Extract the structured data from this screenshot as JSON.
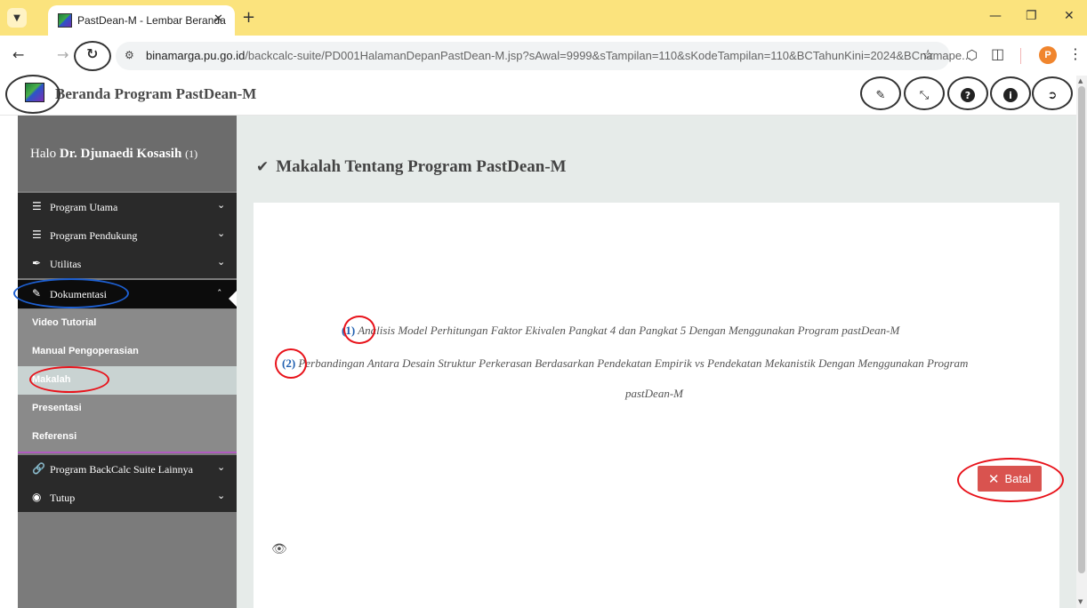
{
  "browser": {
    "tab_title": "PastDean-M - Lembar Beranda",
    "url_host": "binamarga.pu.go.id",
    "url_path": "/backcalc-suite/PD001HalamanDepanPastDean-M.jsp?sAwal=9999&sTampilan=110&sKodeTampilan=110&BCTahunKini=2024&BCnamape...",
    "profile_initial": "P",
    "icons": [
      "tab-search-icon",
      "favicon-icon",
      "tab-close-icon",
      "new-tab-icon",
      "minimize-icon",
      "restore-icon",
      "window-close-icon",
      "back-icon",
      "forward-icon",
      "reload-icon",
      "site-info-icon",
      "bookmark-star-icon",
      "extension-shield-icon",
      "extensions-puzzle-icon",
      "menu-kebab-icon"
    ]
  },
  "app": {
    "title": "Beranda Program PastDean-M",
    "header_icons": [
      "pencil-icon",
      "expand-icon",
      "help-icon",
      "info-icon",
      "logout-icon"
    ]
  },
  "sidebar": {
    "greeting_prefix": "Halo",
    "user_name": "Dr. Djunaedi Kosasih",
    "user_count": "(1)",
    "menu": [
      {
        "label": "Program Utama",
        "icon": "list-icon"
      },
      {
        "label": "Program Pendukung",
        "icon": "list-icon"
      },
      {
        "label": "Utilitas",
        "icon": "feather-icon"
      },
      {
        "label": "Dokumentasi",
        "icon": "pencil-icon"
      },
      {
        "label": "Program BackCalc Suite Lainnya",
        "icon": "link-icon"
      },
      {
        "label": "Tutup",
        "icon": "circle-stop-icon"
      }
    ],
    "submenu": [
      {
        "label": "Video Tutorial"
      },
      {
        "label": "Manual Pengoperasian"
      },
      {
        "label": "Makalah"
      },
      {
        "label": "Presentasi"
      },
      {
        "label": "Referensi"
      }
    ]
  },
  "main": {
    "section_title": "Makalah Tentang Program PastDean-M",
    "papers": [
      {
        "num": "(1)",
        "title": "Analisis Model Perhitungan Faktor Ekivalen Pangkat 4 dan Pangkat 5 Dengan Menggunakan Program pastDean-M"
      },
      {
        "num": "(2)",
        "title": "Perbandingan Antara Desain Struktur Perkerasan Berdasarkan Pendekatan Empirik vs Pendekatan Mekanistik Dengan Menggunakan Program",
        "title_cont": "pastDean-M"
      }
    ],
    "cancel_label": "Batal"
  },
  "colors": {
    "tabstrip": "#fbe37d",
    "sidebar_dark": "#2a2a2a",
    "sidebar_active": "#0c0c0c",
    "submenu_bg": "#8a8a8a",
    "main_bg": "#e6ebe9",
    "cancel_button": "#d9534f",
    "link_number": "#1f5fb0",
    "annotation_red": "#e8121a",
    "annotation_blue": "#1d5fd1"
  }
}
